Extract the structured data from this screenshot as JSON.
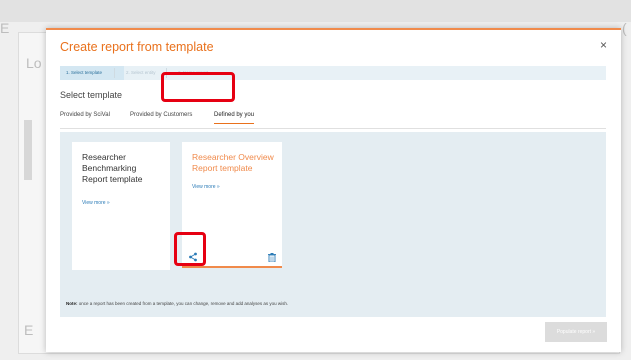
{
  "modal": {
    "title": "Create report from template",
    "close_symbol": "×",
    "steps": [
      "1. Select template",
      "2. Select entity",
      "3. Name report"
    ],
    "section_title": "Select template",
    "tabs": [
      "Provided by SciVal",
      "Provided by Customers",
      "Defined by you"
    ],
    "active_tab": "Defined by you",
    "cards": [
      {
        "title_lines": [
          "Researcher",
          "Benchmarking",
          "Report template"
        ],
        "link": "View more »"
      },
      {
        "title_lines": [
          "Researcher Overview",
          "Report template"
        ],
        "link": "View more »"
      }
    ],
    "note_label": "Note:",
    "note_text": " once a report has been created from a template, you can change, remove and add analyses as you wish.",
    "primary_button": "Populate report »"
  },
  "colors": {
    "accent": "#e9711c",
    "highlight": "#e60012",
    "panel": "#e4edf2"
  }
}
